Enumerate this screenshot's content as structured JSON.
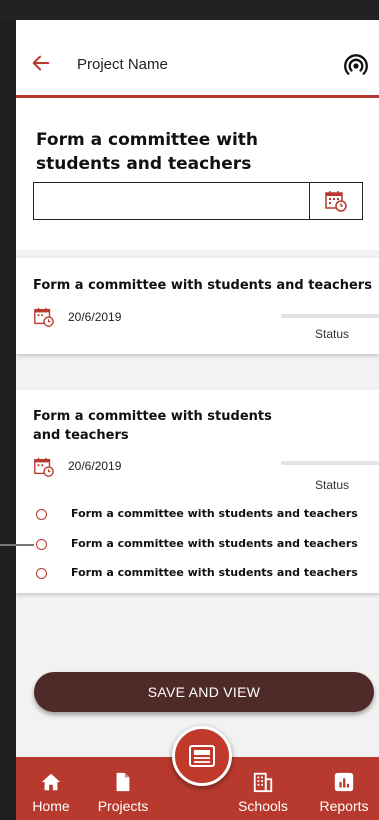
{
  "header": {
    "title": "Project Name"
  },
  "form": {
    "title": "Form a committee with students and teachers",
    "date_value": "",
    "date_placeholder": ""
  },
  "cards": [
    {
      "title": "Form a committee with students and teachers",
      "date": "20/6/2019",
      "status": "Status"
    },
    {
      "title": "Form a committee with students and teachers",
      "date": "20/6/2019",
      "status": "Status",
      "tasks": [
        "Form a committee with students and teachers",
        "Form a committee with students and teachers",
        "Form a committee with students and teachers"
      ]
    }
  ],
  "save_button": {
    "label": "SAVE AND VIEW"
  },
  "nav": {
    "items": [
      {
        "label": "Home",
        "icon": "home-icon"
      },
      {
        "label": "Projects",
        "icon": "document-icon"
      },
      {
        "label": "Schools",
        "icon": "building-icon"
      },
      {
        "label": "Reports",
        "icon": "bar-chart-icon"
      }
    ],
    "fab_icon": "newspaper-icon"
  },
  "colors": {
    "accent": "#b83a2e",
    "button_dark": "#4e2a28",
    "background": "#f2f2f2"
  }
}
